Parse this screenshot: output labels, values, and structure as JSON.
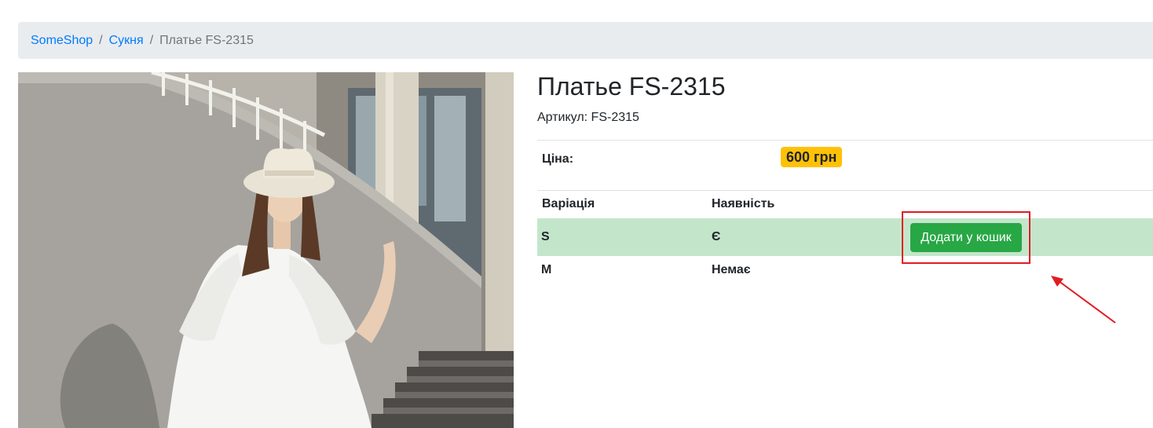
{
  "breadcrumb": {
    "home": "SomeShop",
    "category": "Сукня",
    "current": "Платье FS-2315",
    "separator": "/"
  },
  "product": {
    "title": "Платье FS-2315",
    "sku_text": "Артикул: FS-2315",
    "price_label": "Ціна:",
    "price": "600 грн"
  },
  "variations": {
    "headers": {
      "variation": "Варіація",
      "availability": "Наявність"
    },
    "rows": [
      {
        "size": "S",
        "availability": "Є",
        "button": "Додати у кошик"
      },
      {
        "size": "M",
        "availability": "Немає"
      }
    ]
  },
  "colors": {
    "link": "#007bff",
    "badge": "#ffc107",
    "in_stock_row": "#c3e6cb",
    "button": "#28a745",
    "annotation": "#e31b23"
  }
}
